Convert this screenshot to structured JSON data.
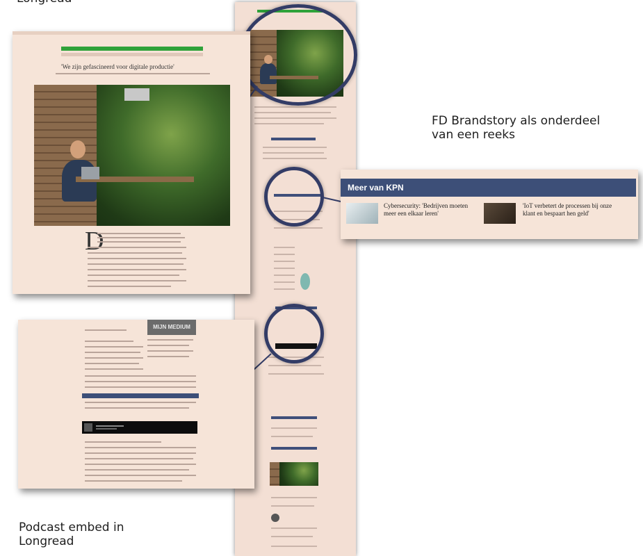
{
  "captions": {
    "top_left": "Longread",
    "brandstory_line1": "FD Brandstory als onderdeel",
    "brandstory_line2": "van een reeks",
    "podcast_line1": "Podcast embed in",
    "podcast_line2": "Longread"
  },
  "more_from": {
    "header": "Meer van KPN",
    "items": [
      {
        "title": "Cybersecurity: 'Bedrijven moeten meer een elkaar leren'"
      },
      {
        "title": "'IoT verbetert de processen bij onze klant en bespaart hen geld'"
      }
    ]
  },
  "article": {
    "headline": "'We zijn gefascineerd voor digitale productie'"
  },
  "podcast": {
    "badge_text": "MIJN MEDIUM"
  },
  "colors": {
    "page_bg": "#f3dfd4",
    "accent_blue": "#3d4f78",
    "ring": "#333c66",
    "green": "#2fa23a"
  }
}
